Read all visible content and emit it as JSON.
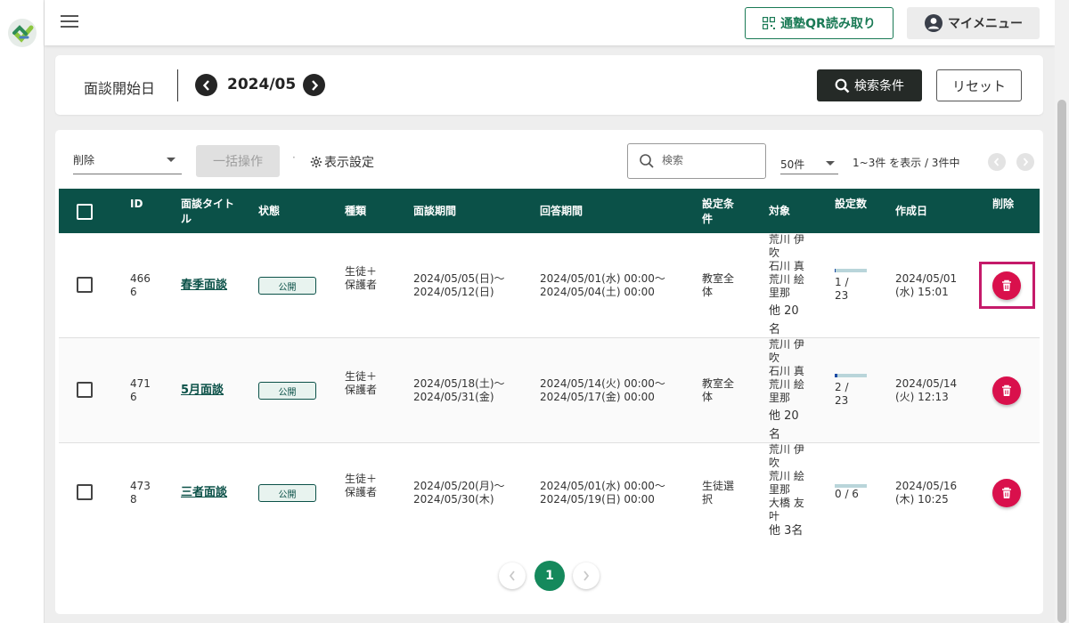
{
  "header": {
    "qr_label": "通塾QR読み取り",
    "my_menu_label": "マイメニュー"
  },
  "date_filter": {
    "label": "面談開始日",
    "value": "2024/05",
    "search_label": "検索条件",
    "reset_label": "リセット"
  },
  "toolbar": {
    "bulk_select_value": "削除",
    "bulk_button_label": "一括操作",
    "display_settings_label": "表示設定",
    "search_placeholder": "検索",
    "per_page_value": "50件",
    "count_text": "1~3件 を表示 / 3件中"
  },
  "table": {
    "headers": {
      "id": "ID",
      "title": "面談タイトル",
      "status": "状態",
      "type": "種類",
      "interview_period": "面談期間",
      "answer_period": "回答期間",
      "condition": "設定条件",
      "target": "対象",
      "setting_count": "設定数",
      "created": "作成日",
      "delete": "削除"
    },
    "rows": [
      {
        "id": "4666",
        "title": "春季面談",
        "status": "公開",
        "type": "生徒＋保護者",
        "period_start": "2024/05/05(日)〜",
        "period_end": "2024/05/12(日)",
        "answer_start": "2024/05/01(水) 00:00〜",
        "answer_end": "2024/05/04(土) 00:00",
        "condition": "教室全体",
        "targets": "荒川 伊吹\n石川 真\n荒川 絵里那",
        "others": "他 20名",
        "count": "1 / 23",
        "progress": 0.04,
        "created_date": "2024/05/01",
        "created_time": "(水) 15:01"
      },
      {
        "id": "4716",
        "title": "5月面談",
        "status": "公開",
        "type": "生徒＋保護者",
        "period_start": "2024/05/18(土)〜",
        "period_end": "2024/05/31(金)",
        "answer_start": "2024/05/14(火) 00:00〜",
        "answer_end": "2024/05/17(金) 00:00",
        "condition": "教室全体",
        "targets": "荒川 伊吹\n石川 真\n荒川 絵里那",
        "others": "他 20名",
        "count": "2 / 23",
        "progress": 0.09,
        "created_date": "2024/05/14",
        "created_time": "(火) 12:13"
      },
      {
        "id": "4738",
        "title": "三者面談",
        "status": "公開",
        "type": "生徒＋保護者",
        "period_start": "2024/05/20(月)〜",
        "period_end": "2024/05/30(木)",
        "answer_start": "2024/05/01(水) 00:00〜",
        "answer_end": "2024/05/19(日) 00:00",
        "condition": "生徒選択",
        "targets": "荒川 伊吹\n荒川 絵里那\n大橋 友叶",
        "others": "他 3名",
        "count": "0 / 6",
        "progress": 0,
        "created_date": "2024/05/16",
        "created_time": "(木) 10:25"
      }
    ]
  },
  "pagination": {
    "current": "1"
  },
  "colors": {
    "primary": "#0b5148",
    "accent": "#15895c",
    "danger": "#d9104c",
    "highlight": "#c51a6a"
  }
}
